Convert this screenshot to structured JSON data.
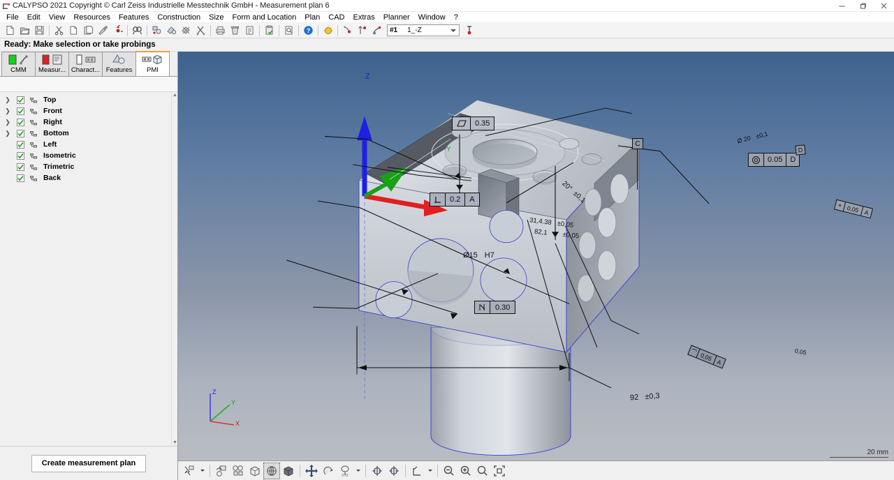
{
  "window": {
    "title": "CALYPSO 2021 Copyright © Carl Zeiss Industrielle Messtechnik GmbH - Measurement plan 6",
    "app_icon": "cmm-icon",
    "minimize": "–",
    "maximize": "❐",
    "close": "✕"
  },
  "menubar": {
    "items": [
      {
        "label": "File"
      },
      {
        "label": "Edit"
      },
      {
        "label": "View"
      },
      {
        "label": "Resources"
      },
      {
        "label": "Features"
      },
      {
        "label": "Construction"
      },
      {
        "label": "Size"
      },
      {
        "label": "Form and Location"
      },
      {
        "label": "Plan"
      },
      {
        "label": "CAD"
      },
      {
        "label": "Extras"
      },
      {
        "label": "Planner"
      },
      {
        "label": "Window"
      },
      {
        "label": "?"
      }
    ]
  },
  "toolbar": {
    "buttons": [
      {
        "name": "new-plan-icon"
      },
      {
        "name": "open-plan-icon"
      },
      {
        "name": "save-plan-icon"
      },
      {
        "name": "cut-icon"
      },
      {
        "name": "copy-icon"
      },
      {
        "name": "paste-icon"
      },
      {
        "name": "format-brush-icon"
      },
      {
        "name": "undo-icon"
      },
      {
        "name": "find-icon"
      },
      {
        "name": "feature-group-icon"
      },
      {
        "name": "feature-edit-icon"
      },
      {
        "name": "feature-delete-icon"
      },
      {
        "name": "tools-icon"
      },
      {
        "name": "print-icon"
      },
      {
        "name": "trash-icon"
      },
      {
        "name": "report-icon"
      },
      {
        "name": "clipboard-save-icon"
      },
      {
        "name": "document-icon"
      },
      {
        "name": "help-icon"
      },
      {
        "name": "bulb-icon"
      },
      {
        "name": "probe-icon"
      },
      {
        "name": "stylus-icon"
      },
      {
        "name": "probe-run-icon"
      }
    ],
    "alignment_combo": {
      "id": "#1",
      "value": "1_-Z",
      "caret": "chevron-down-icon"
    },
    "run_button": "probe-down-icon"
  },
  "status": {
    "text": "Ready: Make selection or take probings"
  },
  "tabs": [
    {
      "label": "CMM",
      "icon": "cmm-status-icon",
      "active": false
    },
    {
      "label": "Measur...",
      "icon": "measurement-icon",
      "active": false
    },
    {
      "label": "Charact...",
      "icon": "characteristics-icon",
      "active": false
    },
    {
      "label": "Features",
      "icon": "features-icon",
      "active": false
    },
    {
      "label": "PMI",
      "icon": "pmi-icon",
      "active": true
    }
  ],
  "tree": {
    "items": [
      {
        "label": "Top",
        "checked": true,
        "expandable": true
      },
      {
        "label": "Front",
        "checked": true,
        "expandable": true
      },
      {
        "label": "Right",
        "checked": true,
        "expandable": true
      },
      {
        "label": "Bottom",
        "checked": true,
        "expandable": true
      },
      {
        "label": "Left",
        "checked": true,
        "expandable": false
      },
      {
        "label": "Isometric",
        "checked": true,
        "expandable": false
      },
      {
        "label": "Trimetric",
        "checked": true,
        "expandable": false
      },
      {
        "label": "Back",
        "checked": true,
        "expandable": false
      }
    ]
  },
  "panel_footer": {
    "create_plan_label": "Create measurement plan"
  },
  "viewport": {
    "scale_label": "20 mm",
    "axis_triad": {
      "x": "X",
      "y": "Y",
      "z": "Z"
    },
    "origin_axis_label": "Z",
    "origin_y_label": "Y",
    "pmi": {
      "flatness_tol": {
        "symbol": "parallelogram",
        "value": "0.35"
      },
      "perpendicularity_tol": {
        "symbol": "perpendicular",
        "value": "0.2",
        "datum": "A"
      },
      "bore_dim": {
        "diameter": "Ø15",
        "fit": "H7"
      },
      "cylindricity_tol": {
        "symbol": "cylindricity",
        "value": "0.30"
      },
      "concentricity_tol": {
        "symbol": "concentricity",
        "value": "0.05",
        "datum": "D"
      },
      "datum_c": "C",
      "datum_d": "D",
      "length_dim": {
        "value": "92",
        "tolerance": "±0,3"
      },
      "angle_dim": {
        "value": "20°",
        "tolerance": "±0,1"
      },
      "dim_a": {
        "value": "31,4.38",
        "tolerance": "±0,05"
      },
      "dim_b": {
        "value": "82,1",
        "tolerance": "±0,05"
      },
      "dia_top": {
        "value": "Ø 20",
        "tolerance": "±0,1"
      },
      "right_tol": {
        "value": "0,05",
        "datum": "A"
      },
      "face_tol": {
        "value": "0,05",
        "datum": "A"
      },
      "lower_tol": {
        "value": "0,05"
      }
    }
  },
  "viewtools": {
    "buttons": [
      {
        "name": "select-probe-tool",
        "caret": true,
        "selected": false
      },
      {
        "name": "feature-select-tool",
        "caret": false,
        "selected": false
      },
      {
        "name": "multi-feature-tool",
        "caret": false,
        "selected": false
      },
      {
        "name": "shaded-box-view",
        "caret": false,
        "selected": false
      },
      {
        "name": "wireframe-view",
        "caret": false,
        "selected": true
      },
      {
        "name": "solid-view",
        "caret": false,
        "selected": false
      },
      {
        "name": "pan-tool",
        "caret": false,
        "selected": false
      },
      {
        "name": "rotate-tool",
        "caret": false,
        "selected": false
      },
      {
        "name": "rotate-xyz-tool",
        "caret": true,
        "selected": false
      },
      {
        "name": "clip-front-tool",
        "caret": false,
        "selected": false
      },
      {
        "name": "clip-back-tool",
        "caret": false,
        "selected": false
      },
      {
        "name": "coordinate-system-tool",
        "caret": true,
        "selected": false
      },
      {
        "name": "zoom-out-button",
        "caret": false,
        "selected": false
      },
      {
        "name": "zoom-in-button",
        "caret": false,
        "selected": false
      },
      {
        "name": "zoom-tool",
        "caret": false,
        "selected": false
      },
      {
        "name": "fit-to-window-button",
        "caret": false,
        "selected": false
      }
    ]
  }
}
